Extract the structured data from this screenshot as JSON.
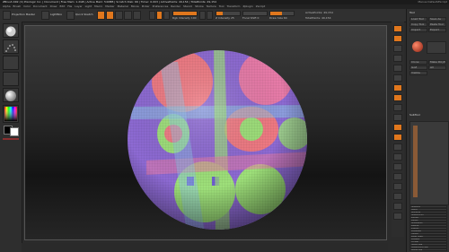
{
  "app": {
    "title": "ZBrush 4R2 (C) Pixologic Inc. | Document | Free Mem: 1.2GB | Active Mem: 540MB | Scratch Disk: 66 | Timer: 0.003 | ActivePoints: 49,154 | TotalPoints: 49,154",
    "title_right": "Menus  DefaultZScript"
  },
  "menus": [
    "Alpha",
    "Brush",
    "Color",
    "Document",
    "Draw",
    "Edit",
    "File",
    "Layer",
    "Light",
    "Macro",
    "Marker",
    "Material",
    "Movie",
    "Picker",
    "Preferences",
    "Render",
    "Stencil",
    "Stroke",
    "Texture",
    "Tool",
    "Transform",
    "Zplugin",
    "Zscript"
  ],
  "top_shelf": {
    "projection_label": "Projection Master",
    "lightbox_label": "LightBox",
    "quick_label": "Quick Sketch",
    "edit_label": "Edit",
    "draw_label": "Draw",
    "move_label": "Move",
    "scale_label": "Scale",
    "rotate_label": "Rotate",
    "mrgb_label": "Mrgb",
    "rgb_label": "Rgb",
    "m_label": "M",
    "zadd_label": "Zadd",
    "zsub_label": "Zsub",
    "rgb_intensity_label": "Rgb Intensity 100",
    "z_intensity_label": "Z Intensity 25",
    "focal_shift_label": "Focal Shift 0",
    "draw_size_label": "Draw Size 64",
    "active_points_label": "ActivePoints: 49,154",
    "total_points_label": "TotalPoints: 49,154",
    "rgb_intensity_value": 1.0,
    "z_intensity_value": 0.25,
    "draw_size_value": 0.5
  },
  "left_shelf": {
    "tiles": [
      "Standard brush",
      "Dots stroke",
      "Alpha off",
      "Texture off",
      "Material"
    ],
    "switch_label": "Switch Color"
  },
  "right_shelf": {
    "icons": [
      "BPR",
      "SPix",
      "Scroll",
      "Zoom",
      "Actual",
      "AAHalf",
      "Persp",
      "Floor",
      "Local",
      "LSym",
      "Xyz",
      "Frame",
      "Move",
      "Scale",
      "Rotate",
      "PolyF",
      "Transp",
      "Ghost",
      "Solo",
      "Xpose"
    ]
  },
  "tray": {
    "header": "Tool",
    "rows": [
      "Load Tool",
      "Save As",
      "Copy Tool",
      "Paste Tool",
      "Import",
      "Export",
      "Clone",
      "Make PolyMesh3D",
      "GoZ",
      "All",
      "Visible"
    ],
    "subtool_header": "SubTool",
    "bottom_rows": [
      "Geometry",
      "Layers",
      "FiberMesh",
      "Geometry HD",
      "Preview",
      "Surface",
      "Deformation",
      "Masking",
      "Visibility",
      "Polygroups",
      "Contact",
      "Morph Target",
      "Polypaint",
      "UV Map",
      "Texture Map",
      "Displacement Map",
      "Normal Map"
    ]
  },
  "colors": {
    "accent": "#e0771d",
    "background": "#2b2b2b",
    "canvas_top": "#3c3c3c",
    "canvas_mid": "#141414"
  }
}
